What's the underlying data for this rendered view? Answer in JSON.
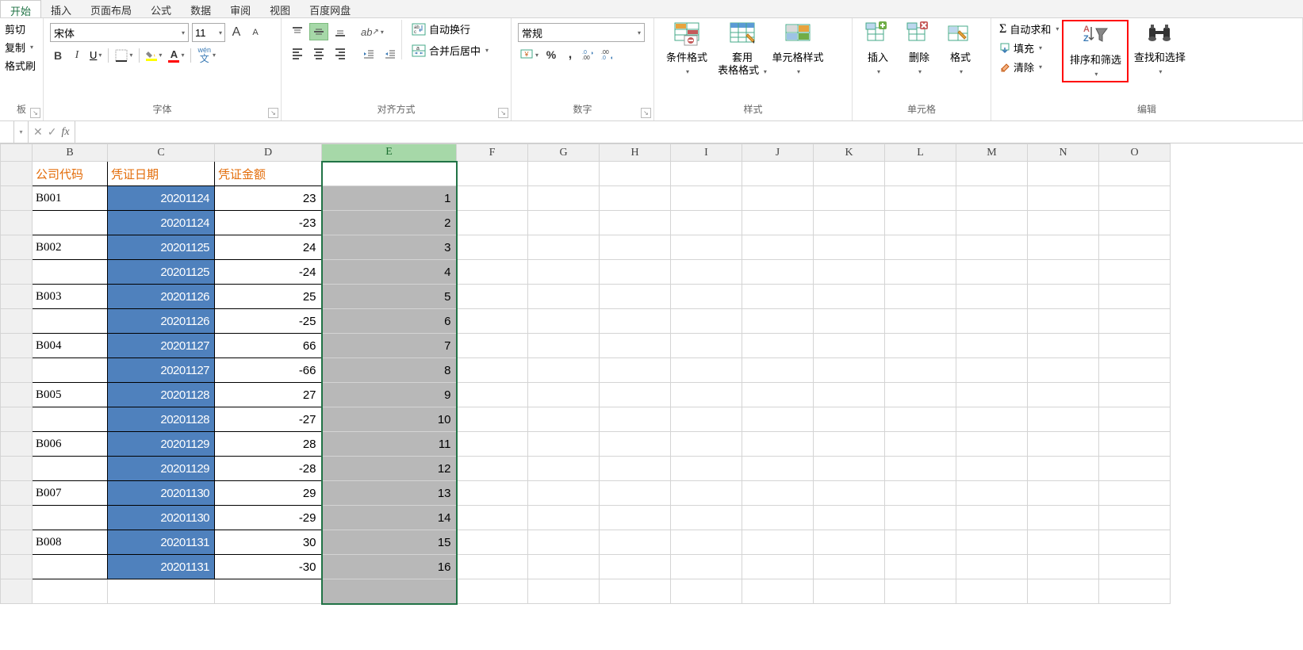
{
  "tabs": {
    "items": [
      "开始",
      "插入",
      "页面布局",
      "公式",
      "数据",
      "审阅",
      "视图",
      "百度网盘"
    ],
    "active": 0
  },
  "clipboard": {
    "cut": "剪切",
    "copy": "复制",
    "format_painter": "格式刷",
    "group_label": "板"
  },
  "font": {
    "name": "宋体",
    "size": "11",
    "increase_label": "A",
    "decrease_label": "A",
    "wen_label": "wén",
    "wen_sub": "文",
    "group_label": "字体"
  },
  "alignment": {
    "wrap_text": "自动换行",
    "merge_center": "合并后居中",
    "group_label": "对齐方式"
  },
  "number": {
    "format": "常规",
    "group_label": "数字"
  },
  "styles": {
    "conditional_format": "条件格式",
    "table_format_l1": "套用",
    "table_format_l2": "表格格式",
    "cell_styles": "单元格样式",
    "group_label": "样式"
  },
  "cells": {
    "insert": "插入",
    "delete": "删除",
    "format": "格式",
    "group_label": "单元格"
  },
  "editing": {
    "autosum": "自动求和",
    "fill": "填充",
    "clear": "清除",
    "sort_filter": "排序和筛选",
    "find_select": "查找和选择",
    "group_label": "编辑"
  },
  "formula_bar": {
    "fx": "fx",
    "value": ""
  },
  "columns": [
    "B",
    "C",
    "D",
    "E",
    "F",
    "G",
    "H",
    "I",
    "J",
    "K",
    "L",
    "M",
    "N",
    "O"
  ],
  "headers": {
    "b": "公司代码",
    "c": "凭证日期",
    "d": "凭证金额"
  },
  "rows": [
    {
      "b": "B001",
      "c": "20201124",
      "d": "23",
      "e": "1"
    },
    {
      "b": "",
      "c": "20201124",
      "d": "-23",
      "e": "2"
    },
    {
      "b": "B002",
      "c": "20201125",
      "d": "24",
      "e": "3"
    },
    {
      "b": "",
      "c": "20201125",
      "d": "-24",
      "e": "4"
    },
    {
      "b": "B003",
      "c": "20201126",
      "d": "25",
      "e": "5"
    },
    {
      "b": "",
      "c": "20201126",
      "d": "-25",
      "e": "6"
    },
    {
      "b": "B004",
      "c": "20201127",
      "d": "66",
      "e": "7"
    },
    {
      "b": "",
      "c": "20201127",
      "d": "-66",
      "e": "8"
    },
    {
      "b": "B005",
      "c": "20201128",
      "d": "27",
      "e": "9"
    },
    {
      "b": "",
      "c": "20201128",
      "d": "-27",
      "e": "10"
    },
    {
      "b": "B006",
      "c": "20201129",
      "d": "28",
      "e": "11"
    },
    {
      "b": "",
      "c": "20201129",
      "d": "-28",
      "e": "12"
    },
    {
      "b": "B007",
      "c": "20201130",
      "d": "29",
      "e": "13"
    },
    {
      "b": "",
      "c": "20201130",
      "d": "-29",
      "e": "14"
    },
    {
      "b": "B008",
      "c": "20201131",
      "d": "30",
      "e": "15"
    },
    {
      "b": "",
      "c": "20201131",
      "d": "-30",
      "e": "16"
    }
  ]
}
